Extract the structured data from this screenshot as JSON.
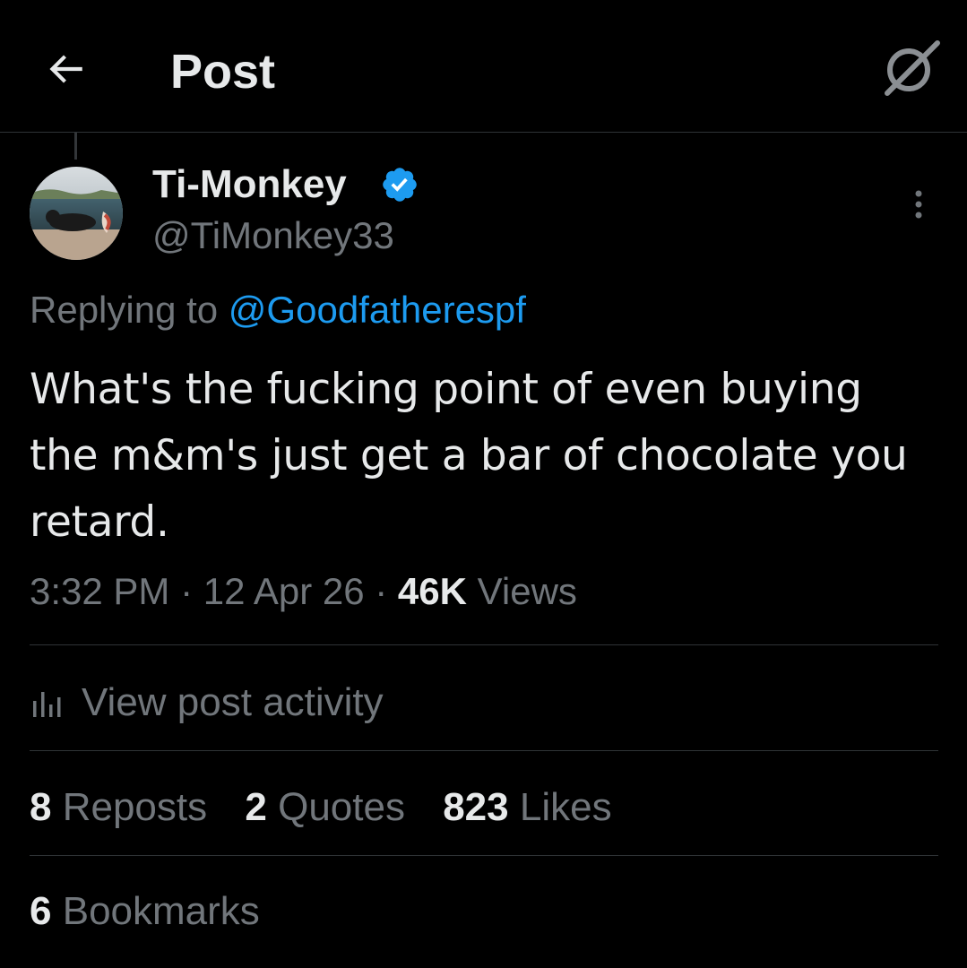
{
  "header": {
    "title": "Post",
    "back_icon": "arrow-left-icon",
    "grok_icon": "grok-icon"
  },
  "author": {
    "display_name": "Ti-Monkey",
    "handle": "@TiMonkey33",
    "verified": true,
    "verified_color": "#1d9bf0"
  },
  "post": {
    "replying_prefix": "Replying to",
    "replying_handle": "@Goodfatherespf",
    "text": "What's the fucking point of even buying the m&m's just get a bar of chocolate you retard.",
    "time": "3:32 PM",
    "date": "12 Apr 26",
    "separator": "·",
    "views_count": "46K",
    "views_label": "Views"
  },
  "activity": {
    "label": "View post activity"
  },
  "stats": {
    "reposts_count": "8",
    "reposts_label": "Reposts",
    "quotes_count": "2",
    "quotes_label": "Quotes",
    "likes_count": "823",
    "likes_label": "Likes",
    "bookmarks_count": "6",
    "bookmarks_label": "Bookmarks"
  },
  "colors": {
    "background": "#000000",
    "text_primary": "#e7e9ea",
    "text_secondary": "#71767b",
    "link": "#1d9bf0",
    "divider": "#2f3336"
  }
}
